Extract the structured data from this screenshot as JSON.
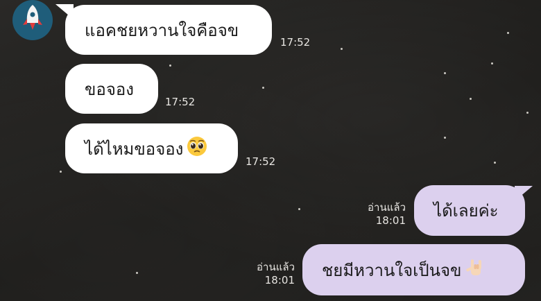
{
  "chat": {
    "incoming": [
      {
        "text": "แอคชยหวานใจคือจข",
        "time": "17:52"
      },
      {
        "text": "ขอจอง",
        "time": "17:52"
      },
      {
        "text": "ได้ไหมขอจอง",
        "time": "17:52",
        "emoji": "pleading-face"
      }
    ],
    "outgoing": [
      {
        "text": "ได้เลยค่ะ",
        "read": "อ่านแล้ว",
        "time": "18:01"
      },
      {
        "text": "ชยมีหวานใจเป็นจข",
        "read": "อ่านแล้ว",
        "time": "18:01",
        "emoji": "love-you-gesture"
      }
    ]
  },
  "colors": {
    "incoming_bubble": "#ffffff",
    "outgoing_bubble": "#dcd0ee",
    "avatar_bg": "#1f5d7a"
  },
  "icons": {
    "avatar": "rocket-icon"
  }
}
